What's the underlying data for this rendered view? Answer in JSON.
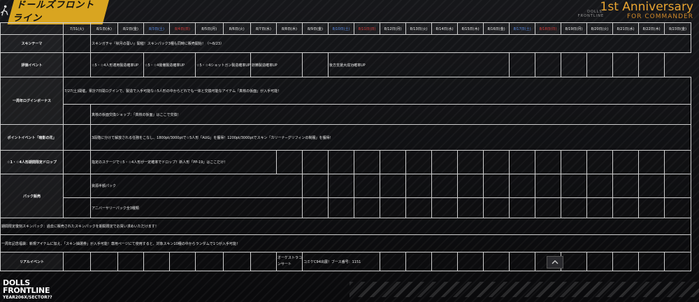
{
  "header": {
    "logo_text": "ドールズフロントライン",
    "anniversary_title": "1st Anniversary",
    "anniversary_sub": "FOR COMMANDER",
    "small_brand": "DOLLS' FRONTLINE"
  },
  "dates": [
    {
      "label": "7/31(火)",
      "kind": "wk"
    },
    {
      "label": "8/1日(水)",
      "kind": "wk"
    },
    {
      "label": "8/2日(金)",
      "kind": "wk"
    },
    {
      "label": "8/3日(土)",
      "kind": "sat"
    },
    {
      "label": "8/4日(日)",
      "kind": "sun"
    },
    {
      "label": "8/5日(月)",
      "kind": "wk"
    },
    {
      "label": "8/6日(火)",
      "kind": "wk"
    },
    {
      "label": "8/7日(水)",
      "kind": "wk"
    },
    {
      "label": "8/8日(木)",
      "kind": "wk"
    },
    {
      "label": "8/9日(金)",
      "kind": "wk"
    },
    {
      "label": "8/10日(土)",
      "kind": "sat"
    },
    {
      "label": "8/11日(日)",
      "kind": "sun"
    },
    {
      "label": "8/12日(月)",
      "kind": "wk"
    },
    {
      "label": "8/13日(火)",
      "kind": "wk"
    },
    {
      "label": "8/14日(水)",
      "kind": "wk"
    },
    {
      "label": "8/15日(木)",
      "kind": "wk"
    },
    {
      "label": "8/16日(金)",
      "kind": "wk"
    },
    {
      "label": "8/17日(土)",
      "kind": "sat"
    },
    {
      "label": "8/18日(日)",
      "kind": "sun"
    },
    {
      "label": "8/19日(月)",
      "kind": "wk"
    },
    {
      "label": "8/20日(火)",
      "kind": "wk"
    },
    {
      "label": "8/21日(水)",
      "kind": "wk"
    },
    {
      "label": "8/22日(木)",
      "kind": "wk"
    },
    {
      "label": "8/23日(金)",
      "kind": "wk"
    }
  ],
  "rows": {
    "skin_theme": {
      "label": "スキンテーマ",
      "event": "スキンガチャ『秋月の誓い』開催！スキンパック3種も同時に販売開始！（〜8/23）"
    },
    "boost": {
      "label": "評価イベント",
      "e1": "☆5・☆4人形適用製造確率UP",
      "e2": "☆5・☆4装備製造確率UP",
      "e3": "☆5・☆4ショットガン製造確率UP",
      "e4": "妖精製造確率UP",
      "e5": "後方支援大成功確率UP"
    },
    "login": {
      "label": "一周年ログインボーナス",
      "e1": "7/27(土)開催。累計7日間ログインで、製造で入手可能な☆5人形の中からどれでも一体と交換可能なアイテム「真核の仮面」が入手可能！",
      "e2": "真核の仮面交換ショップ：「真核の仮面」はここで交換！"
    },
    "point": {
      "label": "ポイントイベント「暗影の花」",
      "event": "3段階に分けて解放される任務をこなし、1800pt/3000ptで☆5人形「AUG」を獲得！1200pt/3000ptでスキン「カリーナ−グリフィンの制服」を獲得！"
    },
    "drop": {
      "label": "☆1・☆4人形期間限定ドロップ",
      "event": "指定のステージで☆5・☆4人形が一定確率でドロップ！新人形「PP-19」はここだけ！"
    },
    "pack": {
      "label": "パック販売",
      "e1": "資源半額パック",
      "e2": "アニバーサリーパック全3種類",
      "e3": "期間限定復刻スキンパック：過去に販売されたスキンパックを期間限定でお買い求めいただけます！",
      "e4": "一周年記念福袋：新規アイテムに加え、「スキン抽選券」が入手可能！専用ページにて使用すると、対象スキン10種の中からランダムで1つが入手可能！"
    },
    "real": {
      "label": "リアルイベント",
      "e1": "オーケストラコンサート",
      "e2": "コミケC94出展！ブース番号：1151"
    }
  },
  "footer": {
    "line1": "DOLLS",
    "line2": "FRONTLINE",
    "line3": "YEAR206X/SECTOR??"
  }
}
